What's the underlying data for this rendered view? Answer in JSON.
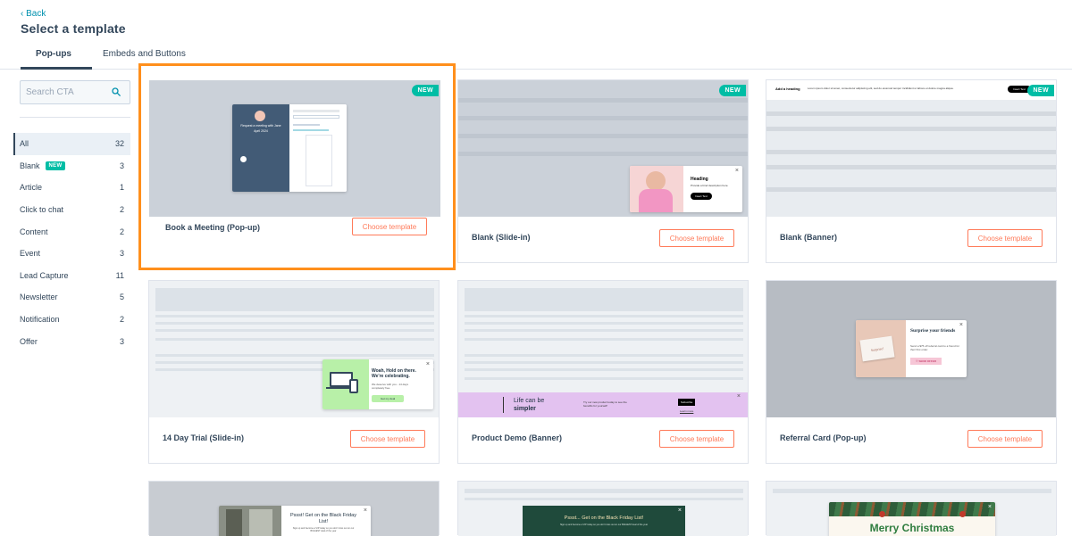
{
  "header": {
    "back_label": "‹ Back",
    "title": "Select a template",
    "tabs": [
      {
        "label": "Pop-ups",
        "active": true
      },
      {
        "label": "Embeds and Buttons",
        "active": false
      }
    ]
  },
  "sidebar": {
    "search_placeholder": "Search CTA",
    "filters": [
      {
        "label": "All",
        "count": "32",
        "active": true
      },
      {
        "label": "Blank",
        "badge": "NEW",
        "count": "3"
      },
      {
        "label": "Article",
        "count": "1"
      },
      {
        "label": "Click to chat",
        "count": "2"
      },
      {
        "label": "Content",
        "count": "2"
      },
      {
        "label": "Event",
        "count": "3"
      },
      {
        "label": "Lead Capture",
        "count": "11"
      },
      {
        "label": "Newsletter",
        "count": "5"
      },
      {
        "label": "Notification",
        "count": "2"
      },
      {
        "label": "Offer",
        "count": "3"
      }
    ]
  },
  "cards": [
    {
      "name": "Book a Meeting (Pop-up)",
      "button": "Choose template",
      "new": "NEW",
      "selected": true
    },
    {
      "name": "Blank (Slide-in)",
      "button": "Choose template",
      "new": "NEW"
    },
    {
      "name": "Blank (Banner)",
      "button": "Choose template",
      "new": "NEW"
    },
    {
      "name": "14 Day Trial (Slide-in)",
      "button": "Choose template"
    },
    {
      "name": "Product Demo (Banner)",
      "button": "Choose template"
    },
    {
      "name": "Referral Card (Pop-up)",
      "button": "Choose template"
    },
    {
      "name": "",
      "button": ""
    },
    {
      "name": "",
      "button": ""
    },
    {
      "name": "",
      "button": ""
    }
  ],
  "previews": {
    "meeting": {
      "text": "Request a meeting with Jane",
      "date": "April 2024"
    },
    "slidein": {
      "heading": "Heading",
      "body": "Provide a brief description here.",
      "button": "Insert Text"
    },
    "banner": {
      "heading": "Add a heading",
      "body": "Lorem ipsum dolor sit amet, consectetur adipiscing elit, sed do eiusmod tempor incididunt ut labore et dolore magna aliqua.",
      "button": "Insert Text"
    },
    "trial": {
      "heading": "Woah, Hold on there. We're celebrating.",
      "body": "We deserve with you - 14 days completely free.",
      "button": "Get my deal"
    },
    "demo": {
      "heading": "Life can be",
      "heading_bold": "simpler",
      "body": "Try our new product today to see the benefits for yourself!",
      "button": "Subscribe",
      "link": "Learn more"
    },
    "referral": {
      "heading": "Surprise your friends",
      "body": "Send a $75 off referral card to a friend for their first order.",
      "button": "SEND OFFER",
      "card_text": "Surprise!"
    },
    "blackfriday_popup": {
      "heading": "Pssst! Get on the Black Friday List!",
      "body": "Sign up and become a VIP today so you don't miss out on our BIGGEST deal of the year"
    },
    "blackfriday_banner": {
      "heading": "Pssst... Get on the Black Friday List!",
      "body": "Sign up and become a VIP today so you don't miss out on our BIGGEST deal of the year"
    },
    "christmas": {
      "heading": "Merry Christmas"
    }
  },
  "colors": {
    "accent": "#ff7a59",
    "selected_border": "#ff8f1c",
    "new_badge": "#00bda5",
    "link": "#0091ae",
    "text": "#33475b"
  }
}
